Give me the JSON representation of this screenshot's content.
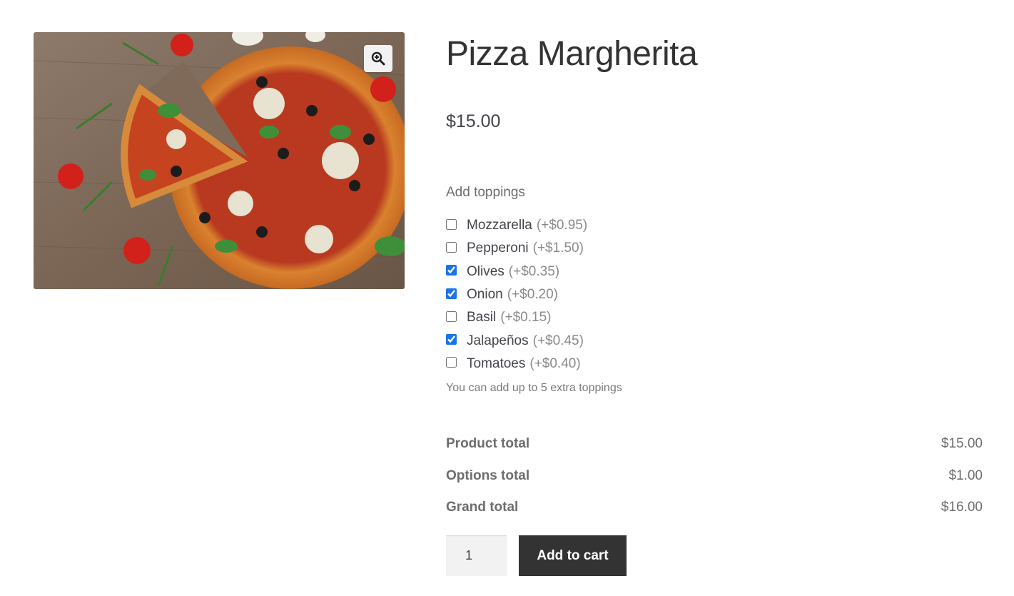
{
  "product": {
    "title": "Pizza Margherita",
    "price": "$15.00",
    "image_alt": "pizza-photo"
  },
  "zoom": {
    "icon": "zoom-in-icon"
  },
  "addons": {
    "title": "Add toppings",
    "items": [
      {
        "name": "Mozzarella",
        "price": "(+$0.95)",
        "checked": false
      },
      {
        "name": "Pepperoni",
        "price": "(+$1.50)",
        "checked": false
      },
      {
        "name": "Olives",
        "price": "(+$0.35)",
        "checked": true
      },
      {
        "name": "Onion",
        "price": "(+$0.20)",
        "checked": true
      },
      {
        "name": "Basil",
        "price": "(+$0.15)",
        "checked": false
      },
      {
        "name": "Jalapeños",
        "price": "(+$0.45)",
        "checked": true
      },
      {
        "name": "Tomatoes",
        "price": "(+$0.40)",
        "checked": false
      }
    ],
    "hint": "You can add up to 5 extra toppings"
  },
  "totals": {
    "rows": [
      {
        "label": "Product total",
        "value": "$15.00"
      },
      {
        "label": "Options total",
        "value": "$1.00"
      },
      {
        "label": "Grand total",
        "value": "$16.00"
      }
    ]
  },
  "cart": {
    "quantity": "1",
    "add_label": "Add to cart"
  },
  "colors": {
    "checkbox_accent": "#1a73e8",
    "button_bg": "#333333"
  }
}
